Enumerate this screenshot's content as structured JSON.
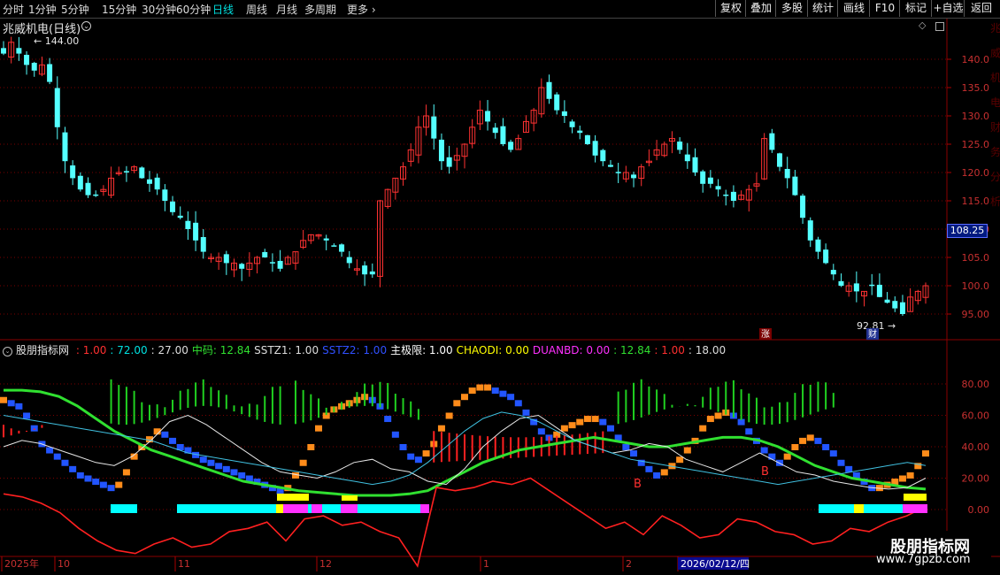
{
  "toolbar": {
    "timeframes": [
      "分时",
      "1分钟",
      "5分钟",
      "15分钟",
      "30分钟",
      "60分钟",
      "日线",
      "周线",
      "月线",
      "多周期",
      "更多"
    ],
    "active_timeframe": "日线",
    "right_buttons": [
      "复权",
      "叠加",
      "多股",
      "统计",
      "画线",
      "F10",
      "标记",
      "+自选",
      "返回"
    ]
  },
  "stock": {
    "title": "兆威机电(日线)"
  },
  "price_chart": {
    "y_ticks": [
      "140.0",
      "135.0",
      "130.0",
      "125.0",
      "120.0",
      "115.0",
      "110.0",
      "105.0",
      "100.0",
      "95.00"
    ],
    "last_price_tag": "108.25",
    "high_label": "144.00",
    "low_label": "92.81",
    "markers": {
      "zhang": "涨",
      "cai": "财"
    },
    "right_edge_text": "兆威机电财务分析"
  },
  "indicator": {
    "name": "股朋指标网",
    "values": [
      {
        "text": ": 1.00",
        "color": "#ff3030"
      },
      {
        "text": ": 72.00",
        "color": "#00e0e0"
      },
      {
        "text": ": 27.00",
        "color": "#dddddd"
      },
      {
        "text": "中码: 12.84",
        "color": "#30e030"
      },
      {
        "text": "SSTZ1: 1.00",
        "color": "#dddddd"
      },
      {
        "text": "SSTZ2: 1.00",
        "color": "#3050ff"
      },
      {
        "text": "主极限: 1.00",
        "color": "#ffffff"
      },
      {
        "text": "CHAODI: 0.00",
        "color": "#ffff00"
      },
      {
        "text": "DUANBD: 0.00",
        "color": "#ff30ff"
      },
      {
        "text": ": 12.84",
        "color": "#30e030"
      },
      {
        "text": ": 1.00",
        "color": "#ff3030"
      },
      {
        "text": ": 18.00",
        "color": "#dddddd"
      }
    ],
    "y_ticks": [
      "80.00",
      "60.00",
      "40.00",
      "20.00",
      "0.00"
    ],
    "labels": {
      "buy_b1": "B",
      "buy_b2": "B"
    }
  },
  "x_axis": {
    "labels": [
      "2025年",
      "10",
      "11",
      "12",
      "1",
      "2",
      "2026/02/12/四"
    ]
  },
  "watermark": {
    "title": "股朋指标网",
    "url": "www.7gpzb.com"
  },
  "colors": {
    "up": "#ff3232",
    "down": "#54ffff",
    "grid": "#7a0000",
    "green_bar": "#20d020",
    "red_bar": "#ff2020",
    "orange": "#ff8c1a",
    "blue": "#2255ff",
    "cyan_band": "#00ffff",
    "yellow": "#ffff00",
    "magenta": "#ff30ff"
  }
}
